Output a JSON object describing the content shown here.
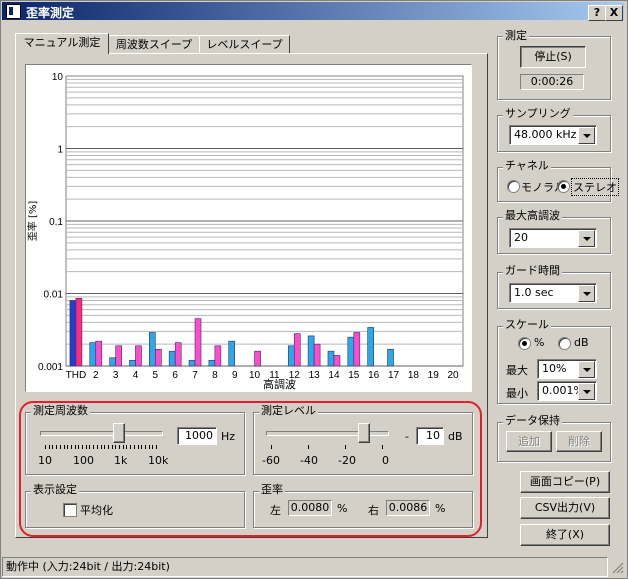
{
  "window": {
    "title": "歪率測定",
    "help_btn": "?",
    "close_btn": "X"
  },
  "tabs": [
    {
      "label": "マニュアル測定",
      "active": true
    },
    {
      "label": "周波数スイープ",
      "active": false
    },
    {
      "label": "レベルスイープ",
      "active": false
    }
  ],
  "chart_data": {
    "type": "bar",
    "scale": "log",
    "ylim": [
      0.001,
      10
    ],
    "yticks": [
      "10",
      "1",
      "0.1",
      "0.01",
      "0.001"
    ],
    "ylabel": "歪率 [%]",
    "xlabel": "高調波",
    "categories": [
      "THD",
      "2",
      "3",
      "4",
      "5",
      "6",
      "7",
      "8",
      "9",
      "10",
      "11",
      "12",
      "13",
      "14",
      "15",
      "16",
      "17",
      "18",
      "19",
      "20"
    ],
    "colors": {
      "left_thd": "#1f3fd0",
      "right_thd": "#ff2a7f",
      "left": "#2aa8ea",
      "right": "#ff4ccf"
    },
    "series": [
      {
        "values": [
          0.008,
          0.0021,
          0.0013,
          0.0012,
          0.0029,
          0.0016,
          0.0012,
          0.0012,
          0.0022,
          0.001,
          0.001,
          0.0019,
          0.0026,
          0.0016,
          0.0025,
          0.0034,
          0.0017,
          0.001,
          0.001,
          0.001
        ]
      },
      {
        "values": [
          0.0086,
          0.0022,
          0.0019,
          0.0019,
          0.0017,
          0.0021,
          0.0045,
          0.0019,
          0.001,
          0.0016,
          0.001,
          0.0028,
          0.002,
          0.0014,
          0.0029,
          0.001,
          0.001,
          0.001,
          0.001,
          0.001
        ]
      }
    ]
  },
  "freq_group": {
    "label": "測定周波数",
    "value": "1000",
    "unit": "Hz",
    "scale_labels": [
      "10",
      "100",
      "1k",
      "10k"
    ],
    "slider_fraction": 0.66
  },
  "level_group": {
    "label": "測定レベル",
    "sign": "-",
    "value": "10",
    "unit": "dB",
    "scale_labels": [
      "-60",
      "-40",
      "-20",
      "0"
    ],
    "slider_fraction": 0.83
  },
  "display_group": {
    "label": "表示設定",
    "average_label": "平均化",
    "average_checked": false
  },
  "distortion_group": {
    "label": "歪率",
    "left_label": "左",
    "left_value": "0.0080",
    "left_unit": "%",
    "right_label": "右",
    "right_value": "0.0086",
    "right_unit": "%"
  },
  "measure_group": {
    "label": "測定",
    "stop_button": "停止(S)",
    "elapsed": "0:00:26"
  },
  "sampling_group": {
    "label": "サンプリング",
    "value": "48.000 kHz"
  },
  "channel_group": {
    "label": "チャネル",
    "mono_label": "モノラル",
    "stereo_label": "ステレオ",
    "selected": "stereo"
  },
  "maxharm_group": {
    "label": "最大高調波",
    "value": "20"
  },
  "guard_group": {
    "label": "ガード時間",
    "value": "1.0 sec"
  },
  "scale_group": {
    "label": "スケール",
    "percent_label": "%",
    "db_label": "dB",
    "selected": "percent",
    "max_label": "最大",
    "max_value": "10%",
    "min_label": "最小",
    "min_value": "0.001%"
  },
  "data_hold_group": {
    "label": "データ保持",
    "add_button": "追加",
    "delete_button": "削除"
  },
  "actions": {
    "copy_button": "画面コピー(P)",
    "csv_button": "CSV出力(V)",
    "exit_button": "終了(X)"
  },
  "status": {
    "text": "動作中 (入力:24bit / 出力:24bit)"
  }
}
